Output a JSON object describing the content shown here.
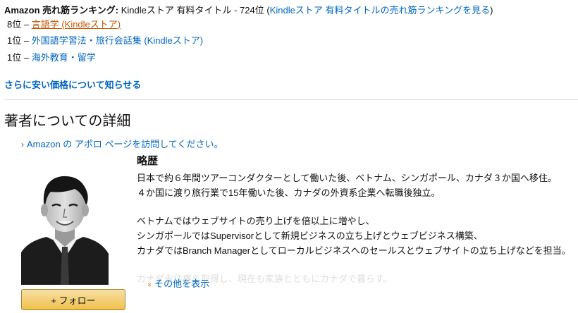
{
  "ranking": {
    "label": "Amazon 売れ筋ランキング:",
    "store_text": "Kindleストア 有料タイトル - 724位",
    "open_paren": "(",
    "link": "Kindleストア 有料タイトルの売れ筋ランキングを見る",
    "close_paren": ")",
    "items": [
      {
        "rank": "8位 –",
        "link": "言語学 (Kindleストア)"
      },
      {
        "rank": "1位 –",
        "link": "外国語学習法・旅行会話集 (Kindleストア)"
      },
      {
        "rank": "1位 –",
        "link": "海外教育・留学"
      }
    ]
  },
  "notify_link": "さらに安い価格について知らせる",
  "author_section": {
    "title": "著者についての詳細",
    "visit_link": "Amazon の アポロ ページを訪問してください。",
    "follow_button": "+ フォロー",
    "bio_heading": "略歴",
    "bio_lines": [
      "日本で約６年間ツアーコンダクターとして働いた後、ベトナム、シンガポール、カナダ３か国へ移住。",
      "４か国に渡り旅行業で15年働いた後、カナダの外資系企業へ転職後独立。",
      "ベトナムではウェブサイトの売り上げを倍以上に増やし、",
      "シンガポールではSupervisorとして新規ビジネスの立ち上げとウェブビジネス構築、",
      "カナダではBranch Managerとしてローカルビジネスへのセールスとウェブサイトの立ち上げなどを担当。",
      "カナダ永住権を取得し、現在も家族とともにカナダで暮らす。"
    ],
    "see_more": "その他を表示"
  },
  "colors": {
    "link": "#0066c0",
    "visited_link": "#c45500",
    "button_gradient_top": "#f7dfa5",
    "button_gradient_bottom": "#f0c14b"
  },
  "icons": [
    "chevron-right-icon",
    "chevron-down-icon"
  ]
}
